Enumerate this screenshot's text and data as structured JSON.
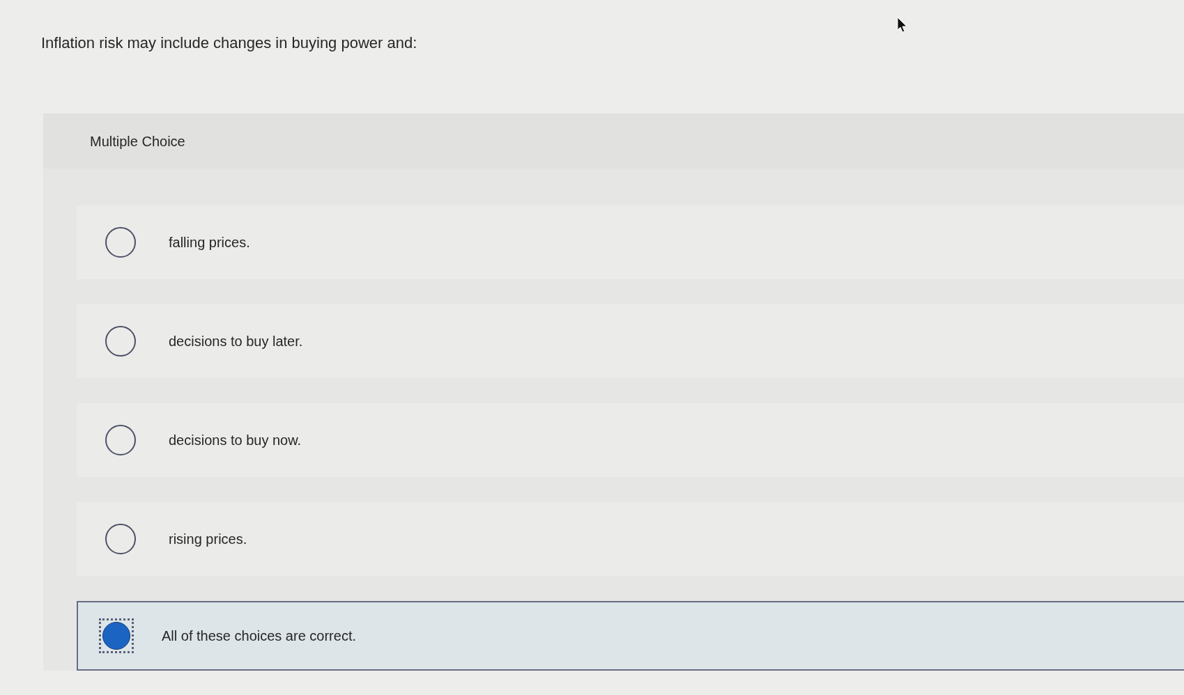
{
  "question": "Inflation risk may include changes in buying power and:",
  "type_label": "Multiple Choice",
  "choices": [
    {
      "label": "falling prices.",
      "selected": false
    },
    {
      "label": "decisions to buy later.",
      "selected": false
    },
    {
      "label": "decisions to buy now.",
      "selected": false
    },
    {
      "label": "rising prices.",
      "selected": false
    },
    {
      "label": "All of these choices are correct.",
      "selected": true
    }
  ]
}
